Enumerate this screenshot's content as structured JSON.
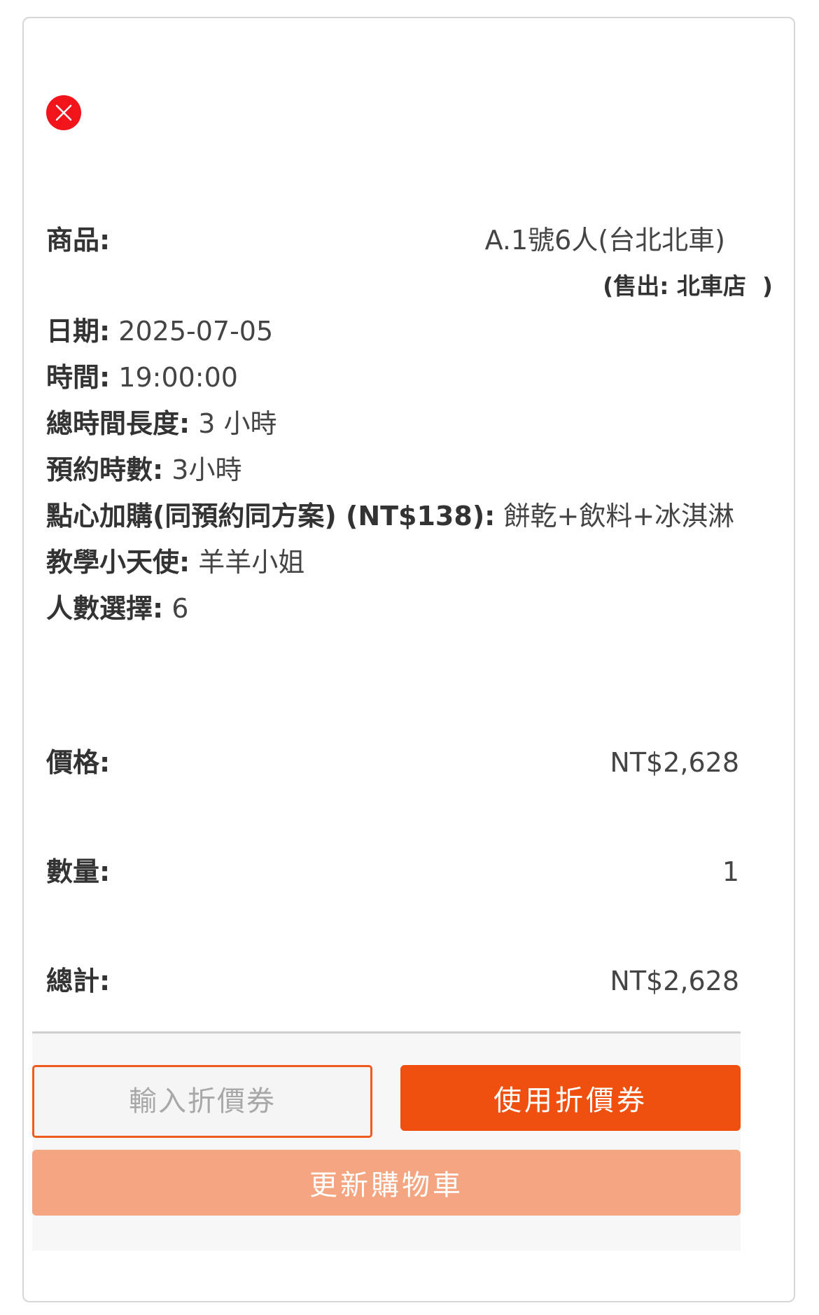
{
  "remove_icon": "close-x-icon",
  "colors": {
    "remove": "#f2141b",
    "accent": "#f0500f",
    "update": "#f4a581",
    "input_border": "#ef5a1f"
  },
  "product": {
    "label": "商品:",
    "name": "A.1號6人(台北北車)",
    "sold_by_prefix": "(售出:",
    "sold_by_store": "北車店",
    "sold_by_suffix": ")"
  },
  "meta": [
    {
      "key": "日期:",
      "value": "2025-07-05"
    },
    {
      "key": "時間:",
      "value": "19:00:00"
    },
    {
      "key": "總時間長度:",
      "value": "3 小時"
    },
    {
      "key": "預約時數:",
      "value": "3小時"
    },
    {
      "key": "點心加購(同預約同方案) (NT$138):",
      "value": "餅乾+飲料+冰淇淋"
    },
    {
      "key": "教學小天使:",
      "value": "羊羊小姐"
    },
    {
      "key": "人數選擇:",
      "value": "6"
    }
  ],
  "price": {
    "label": "價格:",
    "value": "NT$2,628"
  },
  "quantity": {
    "label": "數量:",
    "value": "1"
  },
  "total": {
    "label": "總計:",
    "value": "NT$2,628"
  },
  "coupon": {
    "placeholder": "輸入折價券",
    "value": "",
    "apply_label": "使用折價券"
  },
  "update_cart_label": "更新購物車"
}
